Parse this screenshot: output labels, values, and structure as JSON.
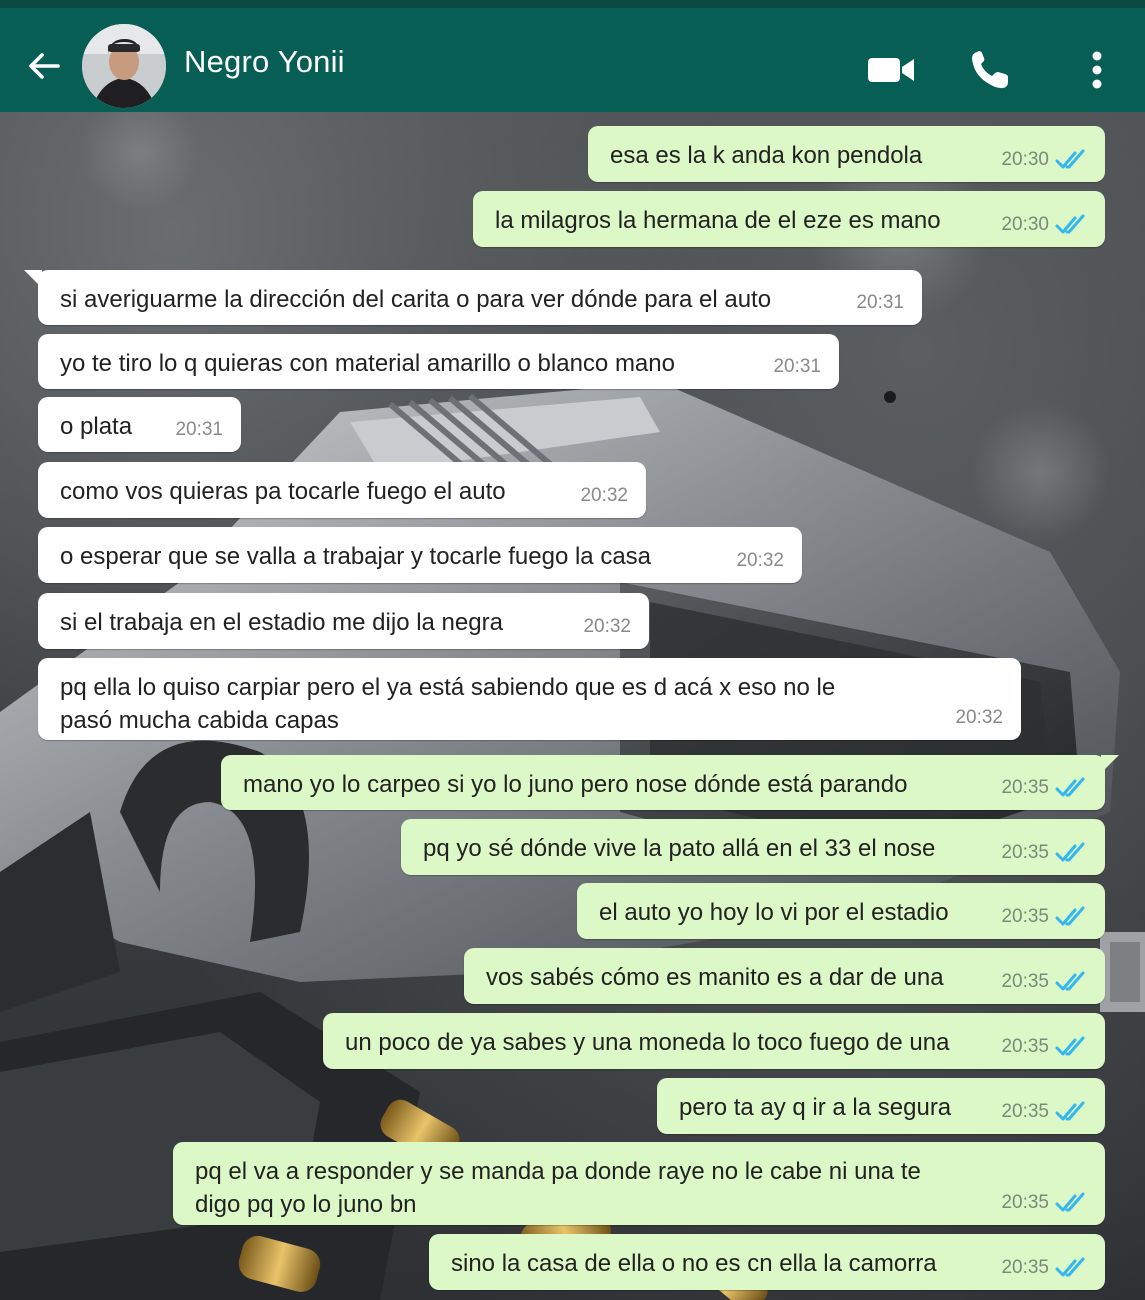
{
  "header": {
    "contact_name": "Negro Yonii",
    "icons": [
      "back-arrow-icon",
      "avatar",
      "video-call-icon",
      "phone-icon",
      "more-options-icon"
    ],
    "color": "#075e54"
  },
  "colors": {
    "outgoing_bubble": "#dcf8c6",
    "incoming_bubble": "#ffffff",
    "read_ticks": "#34b7f1"
  },
  "messages": [
    {
      "direction": "out",
      "text": "esa es la k anda kon pendola",
      "time": "20:30",
      "status": "read"
    },
    {
      "direction": "out",
      "text": "la milagros la hermana de el eze es mano",
      "time": "20:30",
      "status": "read"
    },
    {
      "direction": "in",
      "text": "si averiguarme la dirección del carita o para ver dónde para el auto",
      "time": "20:31"
    },
    {
      "direction": "in",
      "text": "yo te tiro lo q quieras con material amarillo o blanco mano",
      "time": "20:31"
    },
    {
      "direction": "in",
      "text": "o plata",
      "time": "20:31"
    },
    {
      "direction": "in",
      "text": "como vos quieras pa tocarle fuego el auto",
      "time": "20:32"
    },
    {
      "direction": "in",
      "text": "o esperar que se valla a trabajar y tocarle fuego la casa",
      "time": "20:32"
    },
    {
      "direction": "in",
      "text": "si el trabaja en el estadio me dijo la negra",
      "time": "20:32"
    },
    {
      "direction": "in",
      "text": "pq ella lo quiso carpiar pero el ya está sabiendo que es d acá x eso no le pasó mucha cabida capas",
      "time": "20:32"
    },
    {
      "direction": "out",
      "text": "mano yo lo carpeo si yo lo juno pero nose dónde está parando",
      "time": "20:35",
      "status": "read"
    },
    {
      "direction": "out",
      "text": "pq yo sé dónde vive la pato allá en el 33 el nose",
      "time": "20:35",
      "status": "read"
    },
    {
      "direction": "out",
      "text": "el auto yo hoy lo vi por el estadio",
      "time": "20:35",
      "status": "read"
    },
    {
      "direction": "out",
      "text": "vos sabés cómo es manito es a dar de una",
      "time": "20:35",
      "status": "read"
    },
    {
      "direction": "out",
      "text": "un poco de ya sabes y una moneda lo toco fuego de una",
      "time": "20:35",
      "status": "read"
    },
    {
      "direction": "out",
      "text": "pero ta ay q ir a la segura",
      "time": "20:35",
      "status": "read"
    },
    {
      "direction": "out",
      "text": "pq el va a responder y se manda pa donde raye no le cabe ni una te digo pq yo lo juno bn",
      "time": "20:35",
      "status": "read"
    },
    {
      "direction": "out",
      "text": "sino la casa de ella o no es cn ella la camorra",
      "time": "20:35",
      "status": "read"
    }
  ]
}
